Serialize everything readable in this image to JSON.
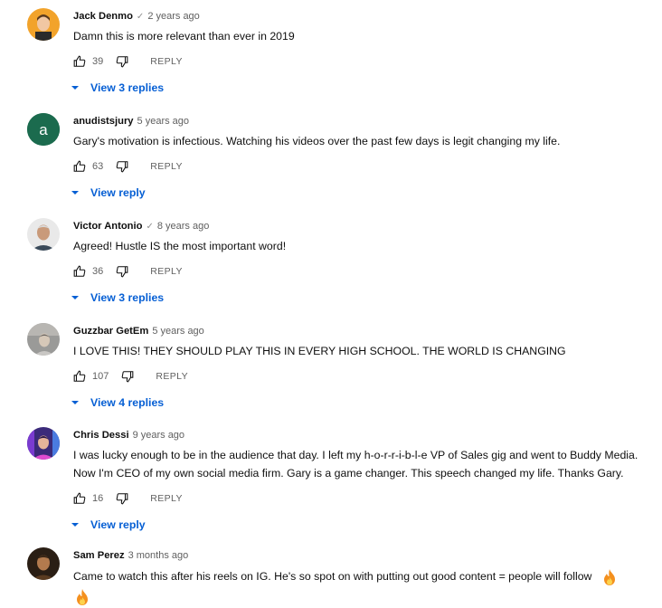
{
  "comments": [
    {
      "author": "Jack Denmo",
      "verified": true,
      "time": "2 years ago",
      "text": "Damn this is more relevant than ever in 2019",
      "likes": "39",
      "reply_label": "REPLY",
      "replies_label": "View 3 replies",
      "avatar": {
        "kind": "photo",
        "bg": "#f2a32b",
        "face": "#f1c7a3",
        "hair": "#5a3a1e",
        "shirt": "#2b2b2b"
      }
    },
    {
      "author": "anudistsjury",
      "verified": false,
      "time": "5 years ago",
      "text": "Gary's motivation is infectious. Watching his videos over the past few days is legit changing my life.",
      "likes": "63",
      "reply_label": "REPLY",
      "replies_label": "View reply",
      "avatar": {
        "kind": "letter",
        "letter": "a",
        "bg": "#1b6b4e",
        "fg": "#ffffff"
      }
    },
    {
      "author": "Victor Antonio",
      "verified": true,
      "time": "8 years ago",
      "text": "Agreed!  Hustle IS the most important word!",
      "likes": "36",
      "reply_label": "REPLY",
      "replies_label": "View 3 replies",
      "avatar": {
        "kind": "photo",
        "bg": "#e9e9e9",
        "face": "#c99a7a",
        "hair": "#d9d9d9",
        "shirt": "#3a4a5a"
      }
    },
    {
      "author": "Guzzbar GetEm",
      "verified": false,
      "time": "5 years ago",
      "text": "I LOVE THIS! THEY SHOULD PLAY THIS IN EVERY HIGH SCHOOL. THE WORLD IS CHANGING",
      "likes": "107",
      "reply_label": "REPLY",
      "replies_label": "View 4 replies",
      "avatar": {
        "kind": "photo",
        "bg": "#9a9a98",
        "face": "#d6c8b8",
        "hair": "#6e6a66",
        "shirt": "#c9c7c4"
      }
    },
    {
      "author": "Chris Dessi",
      "verified": false,
      "time": "9 years ago",
      "text_lines": [
        "I was lucky enough to be in the audience that day.  I left my h-o-r-r-i-b-l-e VP of Sales gig and went to Buddy Media.",
        "Now I'm CEO of my own social media firm.  Gary is a game changer. This speech changed my life.  Thanks Gary."
      ],
      "likes": "16",
      "reply_label": "REPLY",
      "replies_label": "View reply",
      "avatar": {
        "kind": "photo",
        "bg": "#3b2a7a",
        "face": "#e6b49a",
        "hair": "#2a1a4a",
        "shirt": "#e04bd0"
      }
    },
    {
      "author": "Sam Perez",
      "verified": false,
      "time": "3 months ago",
      "text": "Came to watch this after his reels on IG. He's so spot on with putting out good content = people will follow",
      "avatar": {
        "kind": "photo",
        "bg": "#2a1e14",
        "face": "#b27a4e",
        "hair": "#3a2616",
        "shirt": "#5a3b20"
      }
    }
  ],
  "colors": {
    "link_blue": "#065fd4",
    "secondary_text": "#606060",
    "flame": "#f4901e"
  },
  "icons": {
    "like": "thumb-up-icon",
    "dislike": "thumb-down-icon",
    "verified": "check-icon",
    "expand": "caret-down-icon",
    "emoji": "fire-emoji-icon"
  }
}
